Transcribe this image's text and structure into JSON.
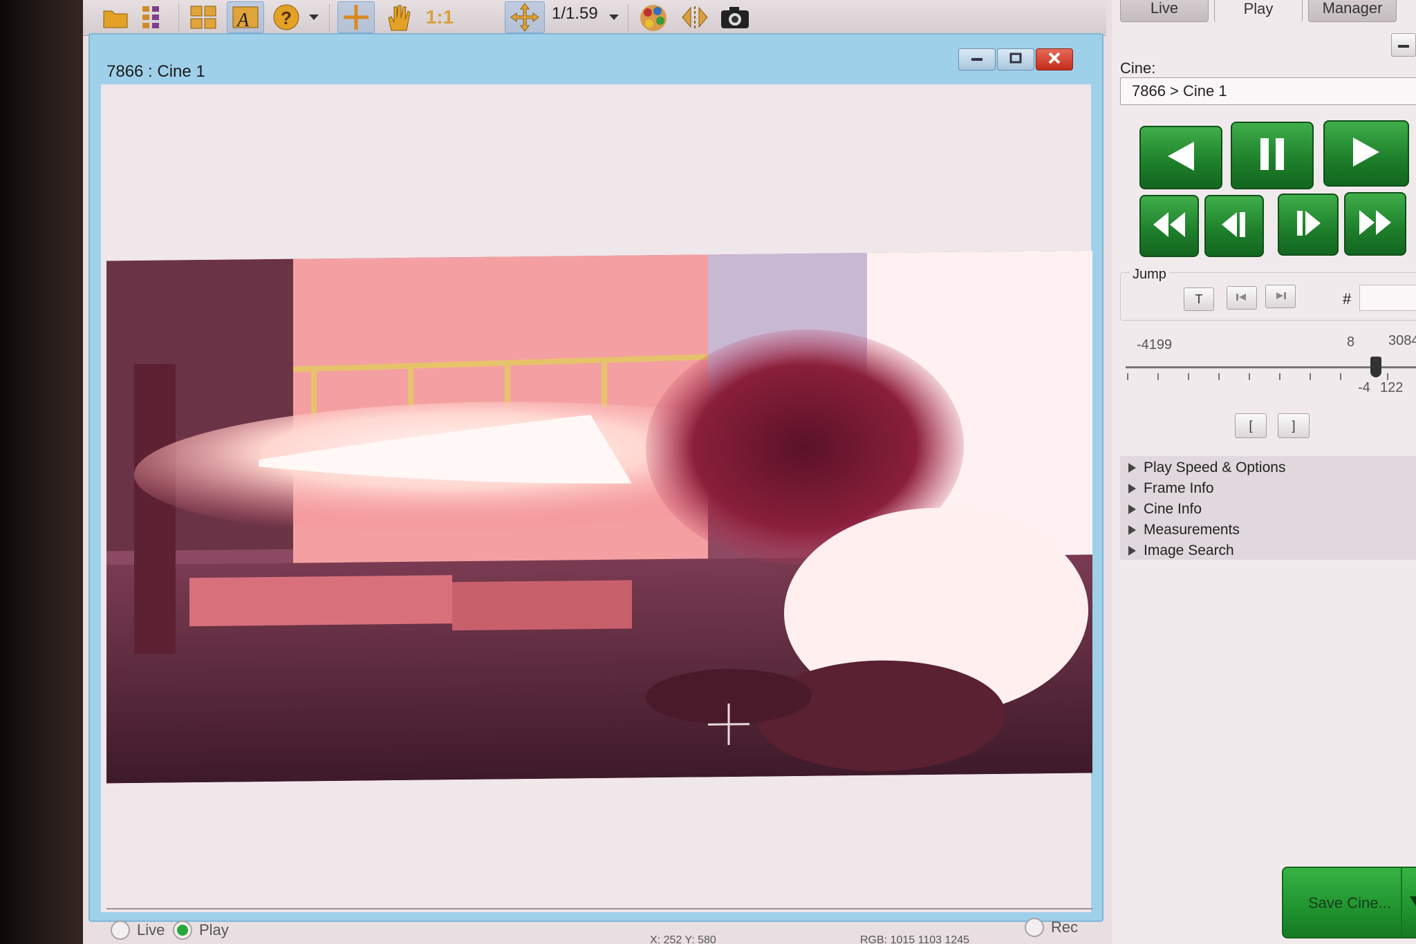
{
  "toolbar": {
    "zoom_value": "1/1.59",
    "icons": [
      "folder-open-icon",
      "layout-grid-icon",
      "grid-icon",
      "annotate-icon",
      "help-icon",
      "dropdown-icon",
      "crosshair-icon",
      "hand-pan-icon",
      "zoom-1-1-icon",
      "fit-move-icon",
      "zoom-dropdown-icon",
      "color-palette-icon",
      "flip-icon",
      "camera-icon"
    ],
    "zoom_1to1_label": "1:1"
  },
  "window": {
    "title": "7866 : Cine 1",
    "video_description_hidden": false,
    "radios": {
      "live": "Live",
      "play": "Play",
      "rec": "Rec"
    }
  },
  "panel": {
    "tabs": [
      "Live",
      "Play",
      "Manager"
    ],
    "active_tab": "Play",
    "cine_label": "Cine:",
    "cine_value": "7866 > Cine 1",
    "jump_label": "Jump",
    "jump_buttons": {
      "t": "T",
      "hash": "#"
    },
    "slider": {
      "min": "-4199",
      "current": "8",
      "max": "3084",
      "sub_left": "-4",
      "sub_right": "122",
      "position_fraction": 0.58
    },
    "mark_buttons": {
      "in": "[",
      "out": "]"
    },
    "sections": [
      "Play Speed & Options",
      "Frame Info",
      "Cine Info",
      "Measurements",
      "Image Search"
    ],
    "save_label": "Save Cine..."
  },
  "status": {
    "coords": "X: 252 Y: 580",
    "rgb": "RGB: 1015 1103 1245"
  },
  "colors": {
    "play_green": "#1d7e2a",
    "close_red": "#c42c1a",
    "accent_blue": "#9fd0ea"
  }
}
